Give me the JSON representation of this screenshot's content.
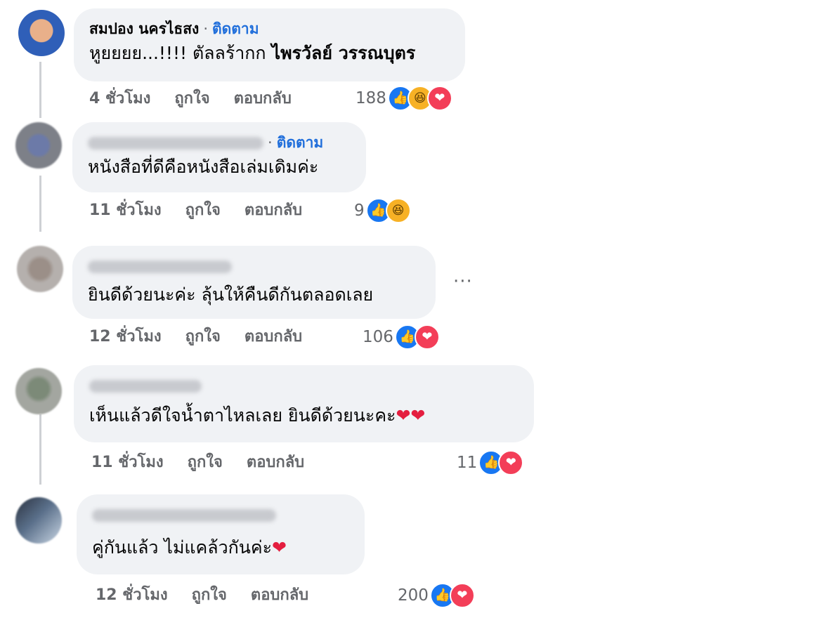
{
  "comments": [
    {
      "author": "สมปอง นครไธสง",
      "follow": "ติดตาม",
      "text": "หูยยยย...!!!! ตัลลร้ากก",
      "mention": "ไพรวัลย์ วรรณบุตร",
      "time": "4 ชั่วโมง",
      "like": "ถูกใจ",
      "reply": "ตอบกลับ",
      "count": "188",
      "reactions": [
        "like",
        "haha",
        "love"
      ]
    },
    {
      "author": "",
      "follow": "ติดตาม",
      "text": "หนังสือที่ดีคือหนังสือเล่มเดิมค่ะ",
      "time": "11 ชั่วโมง",
      "like": "ถูกใจ",
      "reply": "ตอบกลับ",
      "count": "9",
      "reactions": [
        "like",
        "haha"
      ]
    },
    {
      "author": "",
      "text": "ยินดีด้วยนะค่ะ ลุ้นให้คืนดีกันตลอดเลย",
      "time": "12 ชั่วโมง",
      "like": "ถูกใจ",
      "reply": "ตอบกลับ",
      "count": "106",
      "reactions": [
        "like",
        "love"
      ],
      "more": "···"
    },
    {
      "author": "",
      "text": "เห็นแล้วดีใจน้ำตาไหลเลย ยินดีด้วยนะคะ",
      "emoji": "❤❤",
      "time": "11 ชั่วโมง",
      "like": "ถูกใจ",
      "reply": "ตอบกลับ",
      "count": "11",
      "reactions": [
        "like",
        "love"
      ]
    },
    {
      "author": "",
      "text": "คู่กันแล้ว ไม่แคล้วกันค่ะ",
      "emoji": "❤",
      "time": "12 ชั่วโมง",
      "like": "ถูกใจ",
      "reply": "ตอบกลับ",
      "count": "200",
      "reactions": [
        "like",
        "love"
      ]
    }
  ],
  "colors": {
    "bubble": "#f0f2f5",
    "follow_link": "#216fdb",
    "meta_text": "#65676b",
    "like": "#1877f2",
    "love": "#f33e58",
    "haha": "#f7b125"
  }
}
